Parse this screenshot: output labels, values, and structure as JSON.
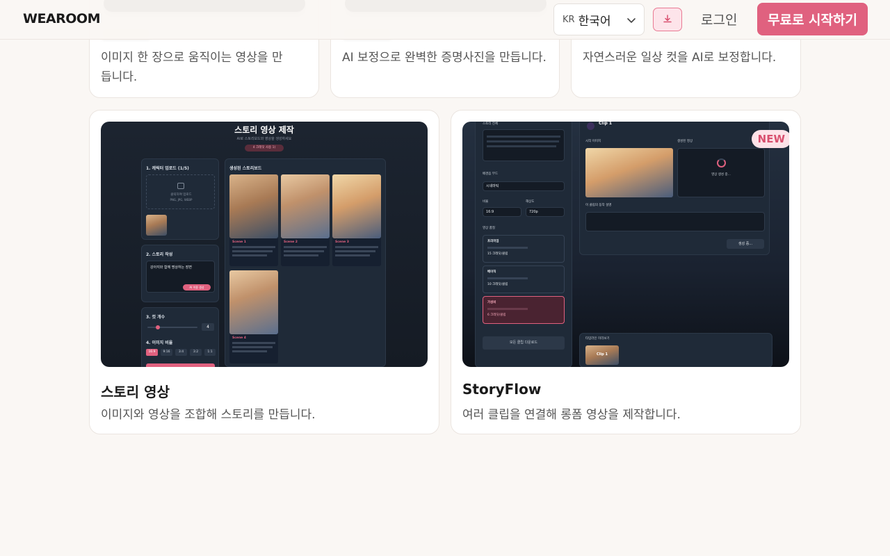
{
  "header": {
    "logo": "WEAROOM",
    "lang_code": "KR",
    "lang_name": "한국어",
    "login": "로그인",
    "cta": "무료로 시작하기"
  },
  "top_cards": [
    {
      "desc": "이미지 한 장으로 움직이는 영상을 만듭니다."
    },
    {
      "desc": "AI 보정으로 완벽한 증명사진을 만듭니다."
    },
    {
      "desc": "자연스러운 일상 컷을 AI로 보정합니다."
    }
  ],
  "cards": [
    {
      "title": "스토리 영상",
      "desc": "이미지와 영상을 조합해 스토리를 만듭니다.",
      "mock": {
        "heading": "스토리 영상 제작",
        "sub": "AI로 스토리보드와 영상을 생성하세요",
        "pill": "4 크레딧 사용 1)",
        "upload_label": "1. 캐릭터 업로드 (1/5)",
        "upload_hint": "클릭하여 업로드",
        "upload_formats": "PNG, JPG, WEBP",
        "storyboard_label": "생성된 스토리보드",
        "story_label": "2. 스토리 작성",
        "story_text": "강아지와 함께 명상하는 장면",
        "ai_btn": "AI 이용 생성",
        "cut_label": "3. 컷 개수",
        "cut_value": "4",
        "ratio_label": "4. 이미지 비율",
        "ratios": [
          "16:9",
          "9:16",
          "3:4",
          "3:2",
          "1:1"
        ],
        "scenes": [
          "Scene 1",
          "Scene 2",
          "Scene 3",
          "Scene 4"
        ]
      }
    },
    {
      "title": "StoryFlow",
      "desc": "여러 클립을 연결해 롱폼 영상을 제작합니다.",
      "badge": "NEW",
      "mock": {
        "story_label": "스토리 전체",
        "bgm_label": "배경음 무드",
        "bgm_value": "시네마틱",
        "ratio_label": "비율",
        "ratio_value": "16:9",
        "res_label": "해상도",
        "res_value": "720p",
        "quality_label": "영상 품질",
        "q1": "프리미엄",
        "q1_cost": "15 크레딧/클립",
        "q2": "베이직",
        "q2_cost": "10 크레딧/클립",
        "q3": "가성비",
        "q3_cost": "6 크레딧/클립",
        "download_all": "모든 클립 다운로드",
        "clip_title": "Clip 1",
        "start_frame": "시작 이미지",
        "generated": "생성된 영상",
        "generating": "영상 생성 중...",
        "prompt_label": "이 클립의 동작 설명",
        "gen_btn": "생성 중...",
        "timeline_label": "타임라인 미리보기",
        "timeline_clip": "Clip 1"
      }
    }
  ]
}
